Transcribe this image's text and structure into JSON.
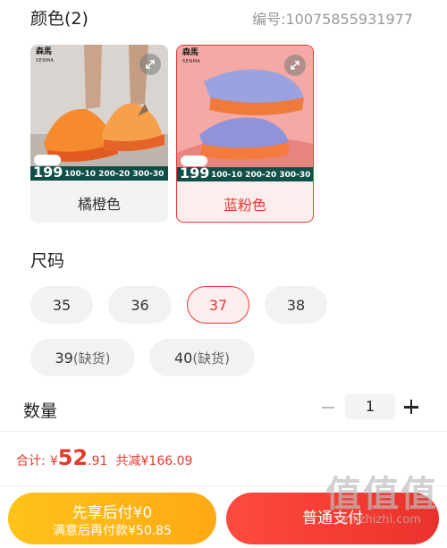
{
  "color_section": {
    "title": "颜色(2)",
    "sku_code": "编号:10075855931977",
    "options": [
      {
        "label": "橘橙色",
        "brand": "森馬",
        "brand_sub": "SENMA",
        "price_badge": "199",
        "promo": "100-10 200-20 300-30",
        "selected": false
      },
      {
        "label": "蓝粉色",
        "brand": "森馬",
        "brand_sub": "SENMA",
        "price_badge": "199",
        "promo": "100-10 200-20 300-30",
        "selected": true
      }
    ]
  },
  "size_section": {
    "title": "尺码",
    "sizes": [
      {
        "label": "35",
        "stock": ""
      },
      {
        "label": "36",
        "stock": ""
      },
      {
        "label": "37",
        "stock": "",
        "selected": true
      },
      {
        "label": "38",
        "stock": ""
      },
      {
        "label": "39",
        "stock": "(缺货)"
      },
      {
        "label": "40",
        "stock": "(缺货)"
      }
    ]
  },
  "quantity_section": {
    "title": "数量",
    "value": "1"
  },
  "total": {
    "label": "合计:",
    "currency": "¥",
    "price_int": "52",
    "price_dec": ".91",
    "saved": "共减¥166.09"
  },
  "buttons": {
    "pay_later_line1": "先享后付¥0",
    "pay_later_line2": "满意后再付款¥50.85",
    "normal_pay": "普通支付"
  },
  "watermark": {
    "big": "值值值",
    "small": "zhizhizhi.com"
  },
  "colors": {
    "accent": "#e5392f",
    "pay_later": "#ffb417",
    "promo_bar": "#0f4f48"
  }
}
